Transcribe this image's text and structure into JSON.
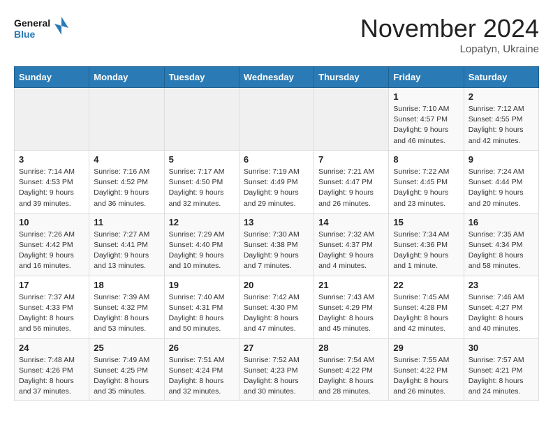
{
  "logo": {
    "line1": "General",
    "line2": "Blue"
  },
  "title": "November 2024",
  "location": "Lopatyn, Ukraine",
  "days_of_week": [
    "Sunday",
    "Monday",
    "Tuesday",
    "Wednesday",
    "Thursday",
    "Friday",
    "Saturday"
  ],
  "weeks": [
    [
      {
        "day": "",
        "info": ""
      },
      {
        "day": "",
        "info": ""
      },
      {
        "day": "",
        "info": ""
      },
      {
        "day": "",
        "info": ""
      },
      {
        "day": "",
        "info": ""
      },
      {
        "day": "1",
        "info": "Sunrise: 7:10 AM\nSunset: 4:57 PM\nDaylight: 9 hours and 46 minutes."
      },
      {
        "day": "2",
        "info": "Sunrise: 7:12 AM\nSunset: 4:55 PM\nDaylight: 9 hours and 42 minutes."
      }
    ],
    [
      {
        "day": "3",
        "info": "Sunrise: 7:14 AM\nSunset: 4:53 PM\nDaylight: 9 hours and 39 minutes."
      },
      {
        "day": "4",
        "info": "Sunrise: 7:16 AM\nSunset: 4:52 PM\nDaylight: 9 hours and 36 minutes."
      },
      {
        "day": "5",
        "info": "Sunrise: 7:17 AM\nSunset: 4:50 PM\nDaylight: 9 hours and 32 minutes."
      },
      {
        "day": "6",
        "info": "Sunrise: 7:19 AM\nSunset: 4:49 PM\nDaylight: 9 hours and 29 minutes."
      },
      {
        "day": "7",
        "info": "Sunrise: 7:21 AM\nSunset: 4:47 PM\nDaylight: 9 hours and 26 minutes."
      },
      {
        "day": "8",
        "info": "Sunrise: 7:22 AM\nSunset: 4:45 PM\nDaylight: 9 hours and 23 minutes."
      },
      {
        "day": "9",
        "info": "Sunrise: 7:24 AM\nSunset: 4:44 PM\nDaylight: 9 hours and 20 minutes."
      }
    ],
    [
      {
        "day": "10",
        "info": "Sunrise: 7:26 AM\nSunset: 4:42 PM\nDaylight: 9 hours and 16 minutes."
      },
      {
        "day": "11",
        "info": "Sunrise: 7:27 AM\nSunset: 4:41 PM\nDaylight: 9 hours and 13 minutes."
      },
      {
        "day": "12",
        "info": "Sunrise: 7:29 AM\nSunset: 4:40 PM\nDaylight: 9 hours and 10 minutes."
      },
      {
        "day": "13",
        "info": "Sunrise: 7:30 AM\nSunset: 4:38 PM\nDaylight: 9 hours and 7 minutes."
      },
      {
        "day": "14",
        "info": "Sunrise: 7:32 AM\nSunset: 4:37 PM\nDaylight: 9 hours and 4 minutes."
      },
      {
        "day": "15",
        "info": "Sunrise: 7:34 AM\nSunset: 4:36 PM\nDaylight: 9 hours and 1 minute."
      },
      {
        "day": "16",
        "info": "Sunrise: 7:35 AM\nSunset: 4:34 PM\nDaylight: 8 hours and 58 minutes."
      }
    ],
    [
      {
        "day": "17",
        "info": "Sunrise: 7:37 AM\nSunset: 4:33 PM\nDaylight: 8 hours and 56 minutes."
      },
      {
        "day": "18",
        "info": "Sunrise: 7:39 AM\nSunset: 4:32 PM\nDaylight: 8 hours and 53 minutes."
      },
      {
        "day": "19",
        "info": "Sunrise: 7:40 AM\nSunset: 4:31 PM\nDaylight: 8 hours and 50 minutes."
      },
      {
        "day": "20",
        "info": "Sunrise: 7:42 AM\nSunset: 4:30 PM\nDaylight: 8 hours and 47 minutes."
      },
      {
        "day": "21",
        "info": "Sunrise: 7:43 AM\nSunset: 4:29 PM\nDaylight: 8 hours and 45 minutes."
      },
      {
        "day": "22",
        "info": "Sunrise: 7:45 AM\nSunset: 4:28 PM\nDaylight: 8 hours and 42 minutes."
      },
      {
        "day": "23",
        "info": "Sunrise: 7:46 AM\nSunset: 4:27 PM\nDaylight: 8 hours and 40 minutes."
      }
    ],
    [
      {
        "day": "24",
        "info": "Sunrise: 7:48 AM\nSunset: 4:26 PM\nDaylight: 8 hours and 37 minutes."
      },
      {
        "day": "25",
        "info": "Sunrise: 7:49 AM\nSunset: 4:25 PM\nDaylight: 8 hours and 35 minutes."
      },
      {
        "day": "26",
        "info": "Sunrise: 7:51 AM\nSunset: 4:24 PM\nDaylight: 8 hours and 32 minutes."
      },
      {
        "day": "27",
        "info": "Sunrise: 7:52 AM\nSunset: 4:23 PM\nDaylight: 8 hours and 30 minutes."
      },
      {
        "day": "28",
        "info": "Sunrise: 7:54 AM\nSunset: 4:22 PM\nDaylight: 8 hours and 28 minutes."
      },
      {
        "day": "29",
        "info": "Sunrise: 7:55 AM\nSunset: 4:22 PM\nDaylight: 8 hours and 26 minutes."
      },
      {
        "day": "30",
        "info": "Sunrise: 7:57 AM\nSunset: 4:21 PM\nDaylight: 8 hours and 24 minutes."
      }
    ]
  ]
}
